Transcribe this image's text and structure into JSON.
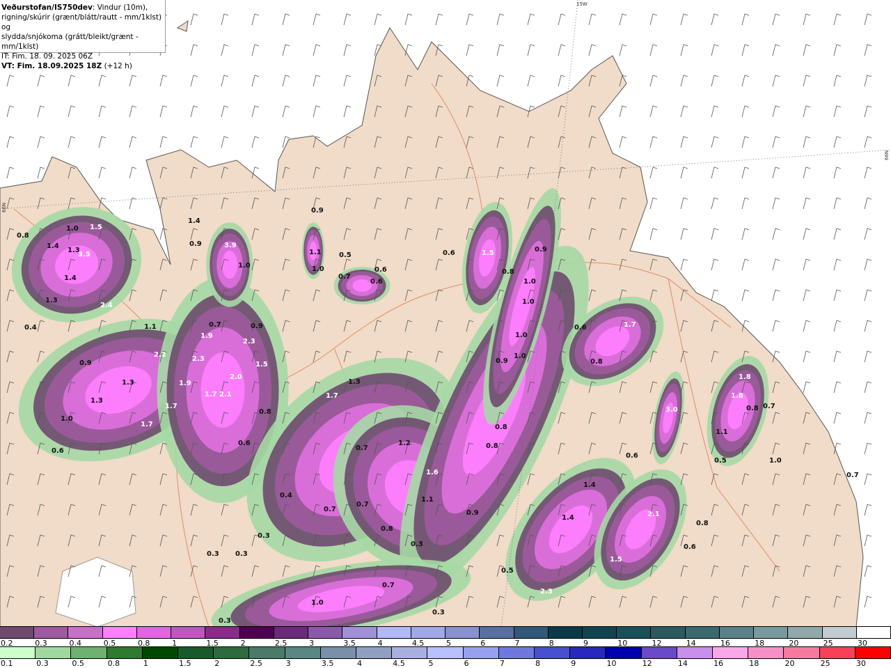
{
  "header": {
    "brand": "Veðurstofan/IS750dev",
    "line1_rest": ": Vindur (10m),",
    "line2": "rigning/skúrir (grænt/blátt/rautt - mm/1klst) og",
    "line3": "slydda/snjókoma (grátt/bleikt/grænt - mm/1klst)",
    "it": "IT: Fim. 18. 09. 2025 06Z",
    "vt_bold": "VT: Fim. 18.09.2025 18Z",
    "vt_rest": " (+12 h)"
  },
  "map": {
    "grid_labels": [
      "15W",
      "66N",
      "66N"
    ],
    "land_color": "#f0dcc8",
    "sea_color": "#ffffff",
    "road_color": "#e07850",
    "precip_values": [
      "0.8",
      "1.0",
      "1.5",
      "1.4",
      "1.3",
      "3.5",
      "1.4",
      "1.3",
      "2.4",
      "0.4",
      "1.1",
      "2.2",
      "0.9",
      "1.3",
      "1.3",
      "1.0",
      "1.7",
      "0.6",
      "1.4",
      "0.9",
      "3.9",
      "1.0",
      "0.7",
      "1.9",
      "2.3",
      "0.9",
      "2.3",
      "1.5",
      "1.9",
      "2.0",
      "1.7",
      "2.1",
      "0.8",
      "0.6",
      "1.7",
      "0.9",
      "1.1",
      "1.0",
      "0.5",
      "0.7",
      "0.6",
      "0.6",
      "1.3",
      "1.7",
      "0.6",
      "1.5",
      "0.9",
      "0.8",
      "1.0",
      "1.0",
      "1.0",
      "0.9",
      "1.0",
      "0.6",
      "1.7",
      "0.8",
      "1.8",
      "1.8",
      "0.8",
      "0.7",
      "3.0",
      "1.2",
      "0.7",
      "0.8",
      "0.8",
      "1.6",
      "1.1",
      "0.4",
      "0.7",
      "0.7",
      "0.9",
      "0.8",
      "0.3",
      "0.3",
      "0.3",
      "0.3",
      "0.6",
      "1.4",
      "1.4",
      "2.1",
      "1.5",
      "0.5",
      "2.3",
      "0.6",
      "0.8",
      "1.1",
      "0.5",
      "1.0",
      "0.7",
      "0.7",
      "1.0",
      "0.3",
      "0.3"
    ]
  },
  "legend_snow": {
    "labels": [
      "0.2",
      "0.3",
      "0.4",
      "0.5",
      "0.8",
      "1",
      "1.5",
      "2",
      "2.5",
      "3",
      "3.5",
      "4",
      "4.5",
      "5",
      "6",
      "7",
      "8",
      "9",
      "10",
      "12",
      "14",
      "16",
      "18",
      "20",
      "25",
      "30"
    ],
    "colors": [
      "#6e4a6e",
      "#9e5a9e",
      "#c870c8",
      "#ff80ff",
      "#e066e0",
      "#c055c0",
      "#8a2a8a",
      "#500050",
      "#6a2a7a",
      "#8a5aaa",
      "#a090d8",
      "#b0b8f8",
      "#a0a8e8",
      "#8890d0",
      "#5870a0",
      "#305878",
      "#0a3a48",
      "#104550",
      "#1a5058",
      "#2a5a60",
      "#3a6a70",
      "#5a8088",
      "#789a9e",
      "#90a8aa",
      "#c0ccd0",
      "#ffffff"
    ]
  },
  "legend_rain": {
    "labels": [
      "0.1",
      "0.3",
      "0.5",
      "0.8",
      "1",
      "1.5",
      "2",
      "2.5",
      "3",
      "3.5",
      "4",
      "4.5",
      "5",
      "6",
      "7",
      "8",
      "9",
      "10",
      "12",
      "14",
      "16",
      "18",
      "20",
      "25",
      "30"
    ],
    "colors": [
      "#ccffcc",
      "#a0d8a0",
      "#70b070",
      "#2e7a2e",
      "#004800",
      "#1a5a2a",
      "#2e6a40",
      "#4a7a68",
      "#5a8880",
      "#7890a8",
      "#90a0c0",
      "#a8b0e0",
      "#b8c0ff",
      "#98a0f0",
      "#7078e0",
      "#4850d0",
      "#2828c0",
      "#0000b0",
      "#6a4ac8",
      "#c890e8",
      "#f8a8e8",
      "#f890c8",
      "#f878a0",
      "#f84058",
      "#ff0000"
    ]
  }
}
